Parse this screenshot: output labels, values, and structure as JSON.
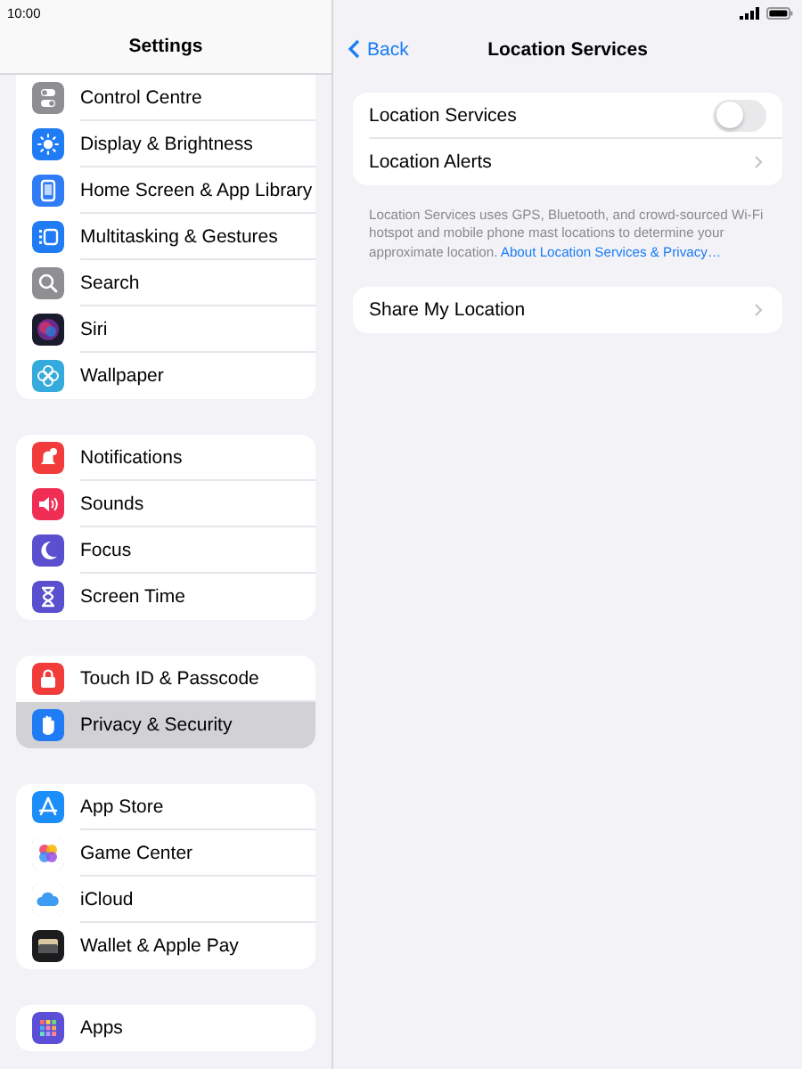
{
  "status_bar": {
    "time": "10:00"
  },
  "sidebar": {
    "title": "Settings",
    "groups": [
      [
        {
          "label": "Control Centre",
          "kind": "switches",
          "selected": false
        },
        {
          "label": "Display & Brightness",
          "kind": "sun",
          "selected": false
        },
        {
          "label": "Home Screen & App Library",
          "kind": "phone",
          "selected": false
        },
        {
          "label": "Multitasking & Gestures",
          "kind": "multitask",
          "selected": false
        },
        {
          "label": "Search",
          "kind": "search",
          "selected": false
        },
        {
          "label": "Siri",
          "kind": "orb",
          "selected": false
        },
        {
          "label": "Wallpaper",
          "kind": "flower",
          "selected": false
        }
      ],
      [
        {
          "label": "Notifications",
          "kind": "bell",
          "selected": false
        },
        {
          "label": "Sounds",
          "kind": "speaker",
          "selected": false
        },
        {
          "label": "Focus",
          "kind": "moon",
          "selected": false
        },
        {
          "label": "Screen Time",
          "kind": "hourglass",
          "selected": false
        }
      ],
      [
        {
          "label": "Touch ID & Passcode",
          "kind": "lock",
          "selected": false
        },
        {
          "label": "Privacy & Security",
          "kind": "hand",
          "selected": true
        }
      ],
      [
        {
          "label": "App Store",
          "kind": "store",
          "selected": false
        },
        {
          "label": "Game Center",
          "kind": "bubbles",
          "selected": false
        },
        {
          "label": "iCloud",
          "kind": "cloud",
          "selected": false
        },
        {
          "label": "Wallet & Apple Pay",
          "kind": "wallet",
          "selected": false
        }
      ],
      [
        {
          "label": "Apps",
          "kind": "apps",
          "selected": false
        }
      ]
    ]
  },
  "detail": {
    "back": "Back",
    "title": "Location Services",
    "groups": [
      {
        "rows": [
          {
            "kind": "toggle",
            "label": "Location Services",
            "on": false
          },
          {
            "kind": "link",
            "label": "Location Alerts"
          }
        ],
        "footer": {
          "text": "Location Services uses GPS, Bluetooth, and crowd-sourced Wi-Fi hotspot and mobile phone mast locations to determine your approximate location.",
          "link": "About Location Services & Privacy…"
        }
      },
      {
        "rows": [
          {
            "kind": "link",
            "label": "Share My Location"
          }
        ]
      }
    ]
  }
}
